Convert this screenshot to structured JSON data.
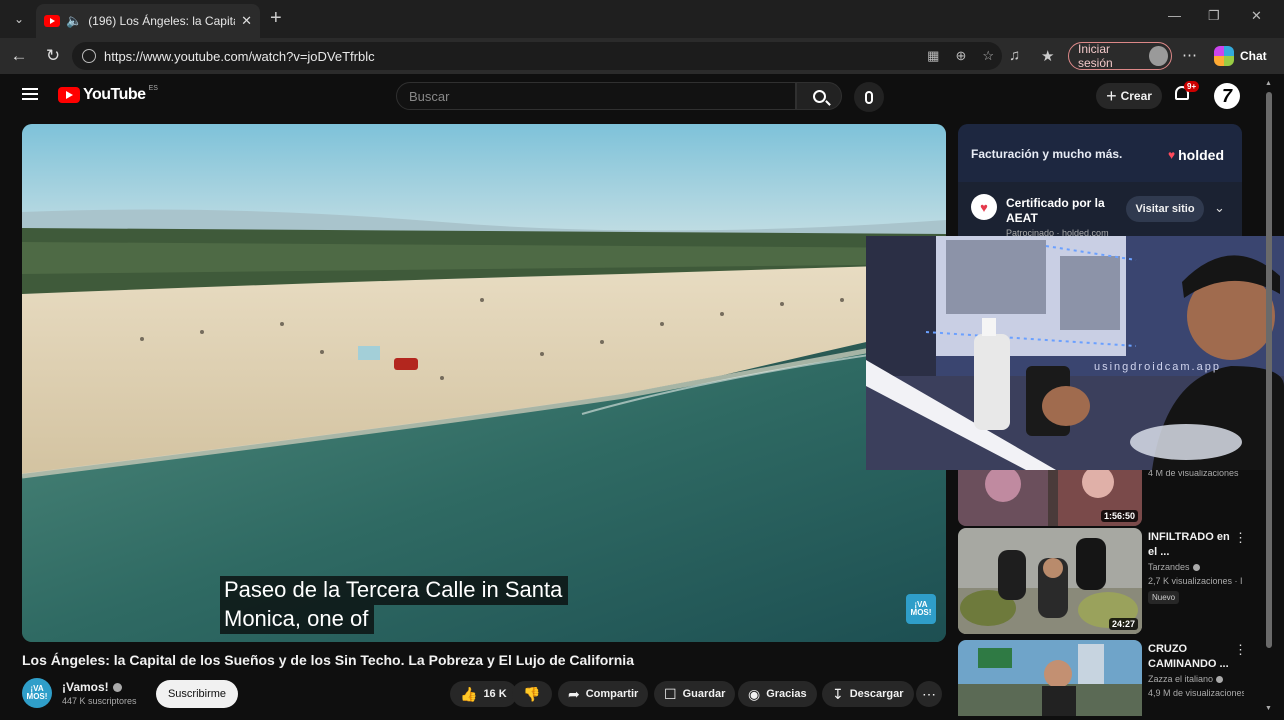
{
  "browser": {
    "tab_title": "(196) Los Ángeles: la Capital de los Sueños y de los Sin Techo",
    "url": "https://www.youtube.com/watch?v=joDVeTfrblc",
    "signin_label": "Iniciar sesión",
    "chat_label": "Chat"
  },
  "youtube": {
    "logo_text": "YouTube",
    "country_code": "ES",
    "search_placeholder": "Buscar",
    "create_label": "Crear",
    "notification_badge": "9+"
  },
  "video": {
    "subtitle_lines": [
      "Paseo de la Tercera Calle in Santa",
      "Monica, one of"
    ],
    "title": "Los Ángeles: la Capital de los Sueños y de los Sin Techo. La Pobreza y El Lujo de California",
    "channel_name": "¡Vamos!",
    "channel_avatar_text": "¡VA MOS!",
    "subscribers": "447 K suscriptores",
    "subscribe_label": "Suscribirme",
    "like_count": "16 K",
    "share_label": "Compartir",
    "save_label": "Guardar",
    "thanks_label": "Gracias",
    "download_label": "Descargar"
  },
  "ad": {
    "headline": "Facturación y mucho más.",
    "brand": "holded",
    "title": "Certificado por la AEAT",
    "sponsor": "Patrocinado · holded.com",
    "visit_label": "Visitar sitio"
  },
  "camera_overlay": {
    "watermark": "usingdroidcam.app"
  },
  "recommendations": [
    {
      "meta": "4 M de visualizaciones",
      "duration": "1:56:50"
    },
    {
      "title": "INFILTRADO en el ...",
      "channel": "Tarzandes",
      "meta": "2,7 K visualizaciones · I",
      "badge": "Nuevo",
      "duration": "24:27"
    },
    {
      "title": "CRUZO CAMINANDO ...",
      "channel": "Zazza el italiano",
      "meta": "4,9 M de visualizaciones"
    }
  ],
  "colors": {
    "youtube_red": "#ff0000",
    "page_background": "#0f0f0f",
    "ad_background": "#1b2232",
    "holded_brand": "#ff4a5c"
  }
}
